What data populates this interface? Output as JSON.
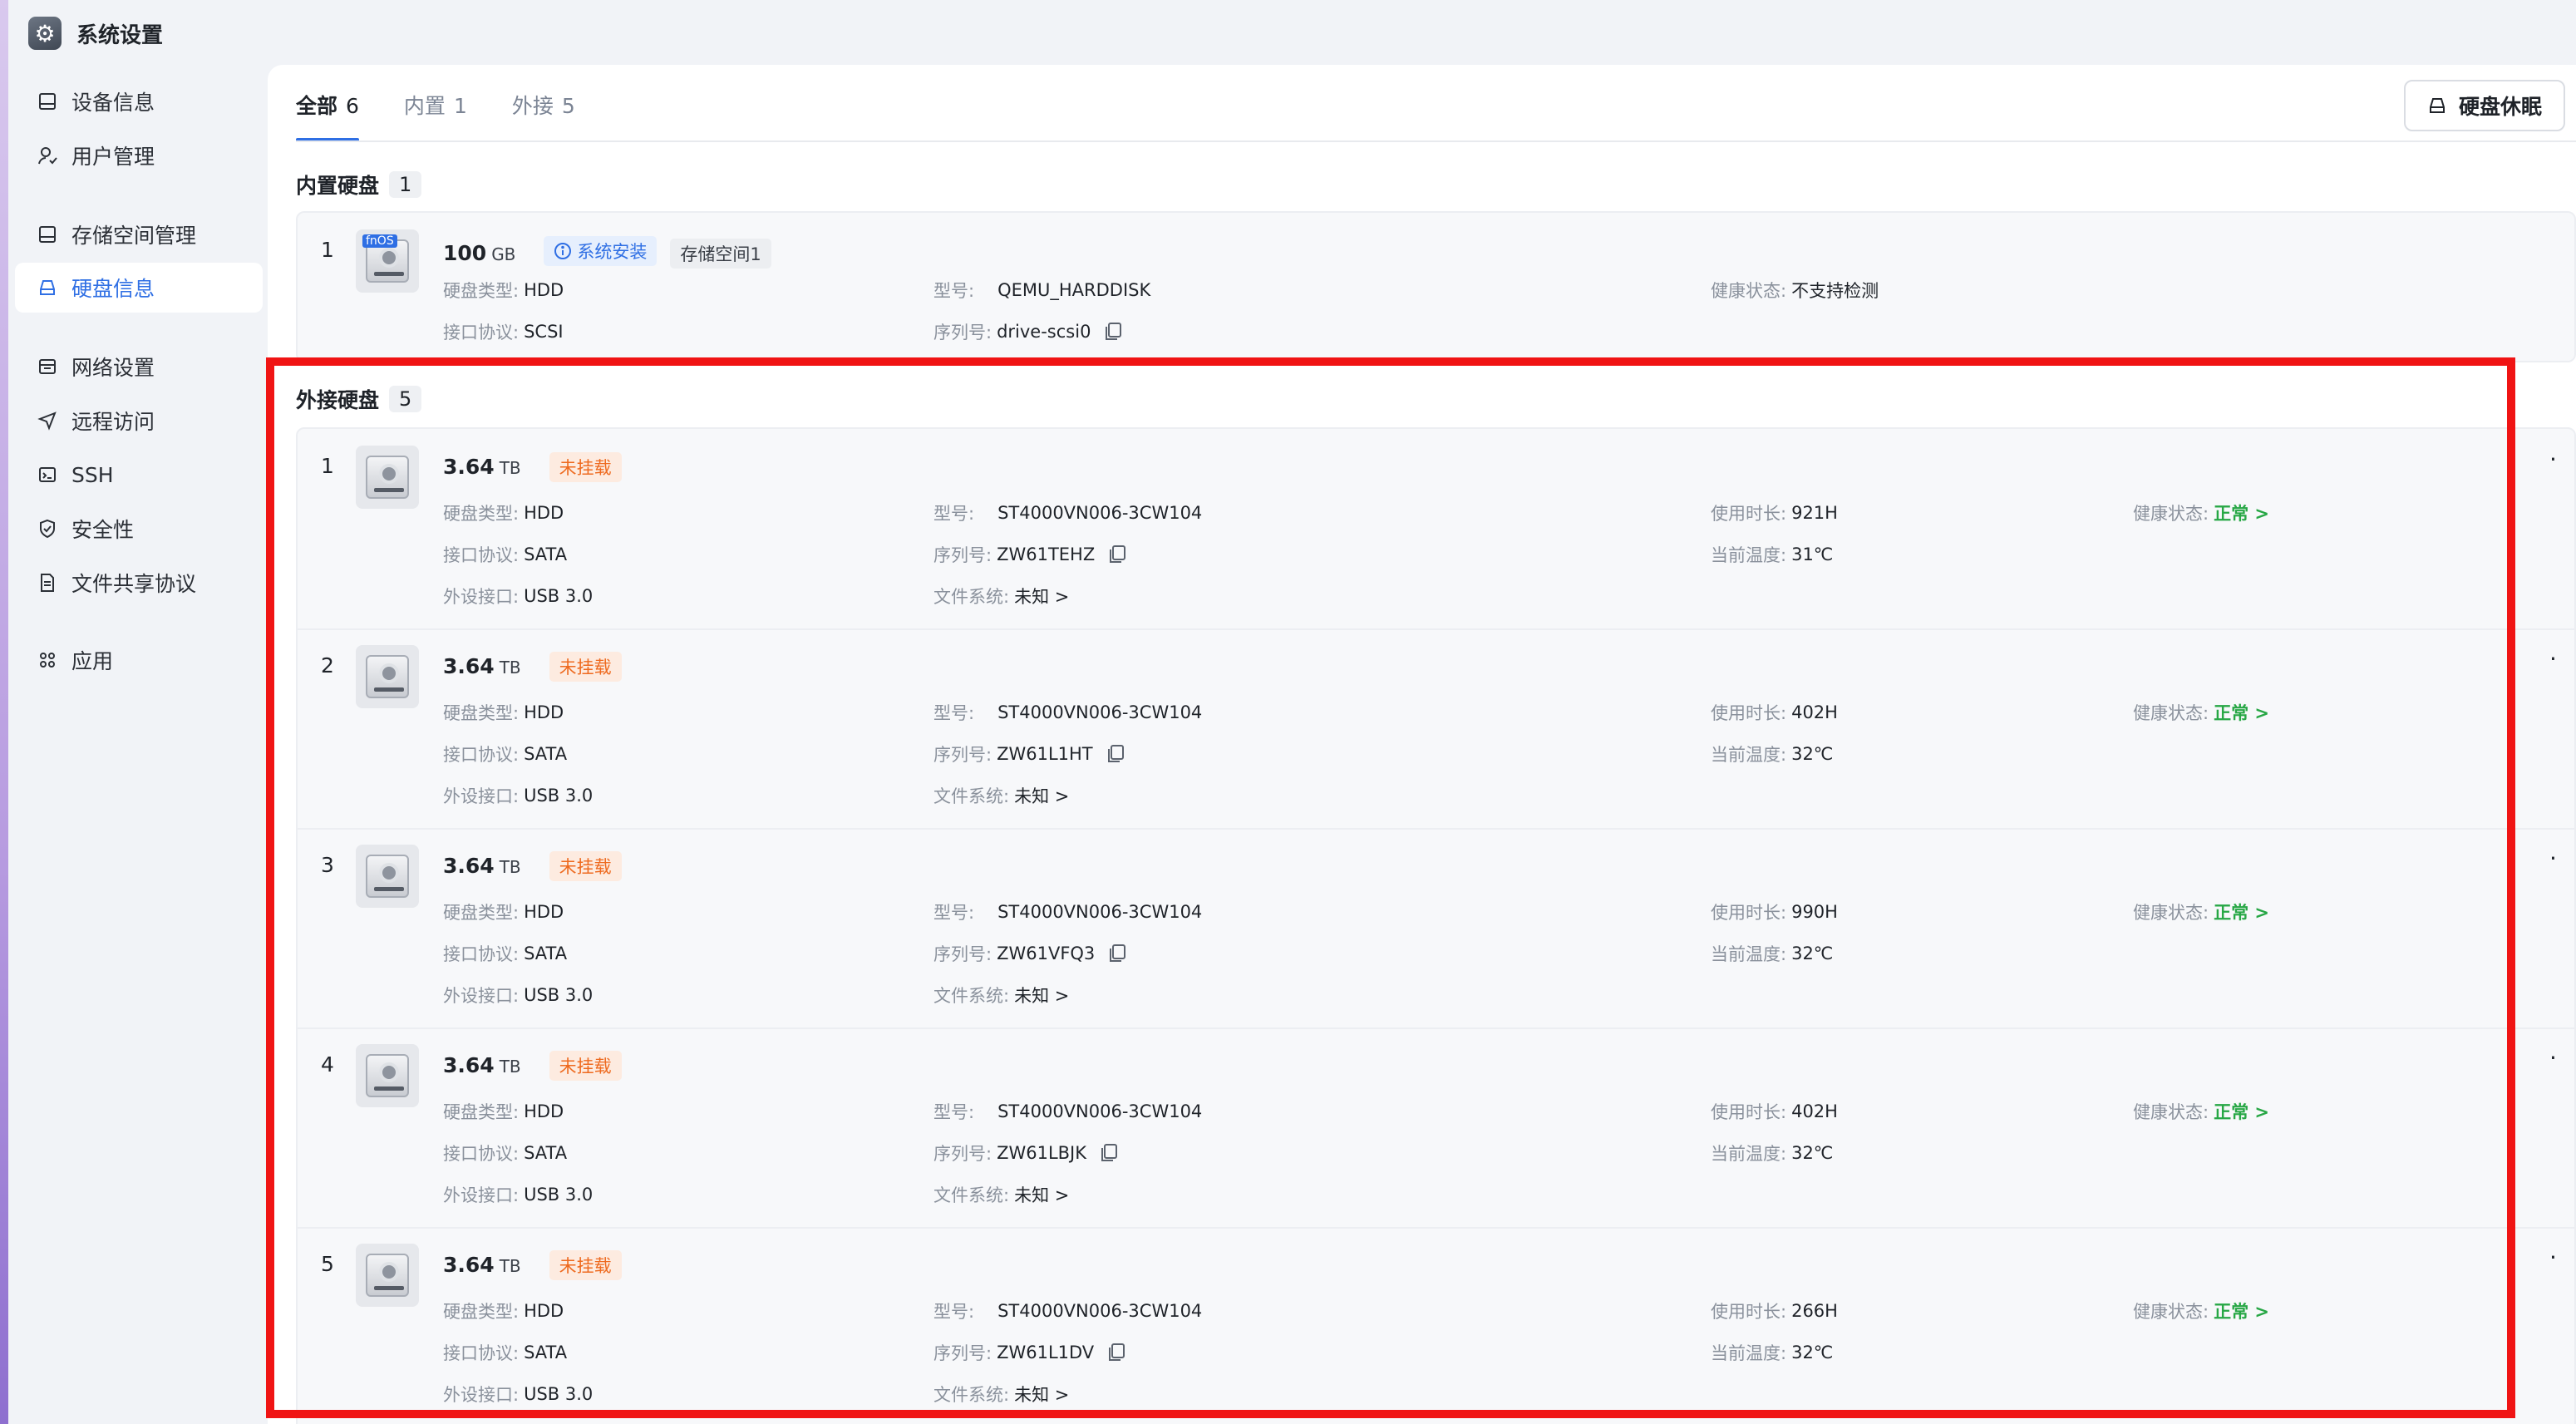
{
  "app": {
    "title": "系统设置",
    "icon": "gear-icon"
  },
  "sidebar": {
    "items": [
      {
        "label": "设备信息",
        "icon": "device-icon"
      },
      {
        "label": "用户管理",
        "icon": "user-icon"
      },
      {
        "label": "存储空间管理",
        "icon": "storage-icon"
      },
      {
        "label": "硬盘信息",
        "icon": "disk-icon",
        "active": true
      },
      {
        "label": "网络设置",
        "icon": "network-icon"
      },
      {
        "label": "远程访问",
        "icon": "send-icon"
      },
      {
        "label": "SSH",
        "icon": "terminal-icon"
      },
      {
        "label": "安全性",
        "icon": "shield-icon"
      },
      {
        "label": "文件共享协议",
        "icon": "file-icon"
      },
      {
        "label": "应用",
        "icon": "apps-icon"
      }
    ]
  },
  "tabs": [
    {
      "label": "全部",
      "count": "6",
      "active": true
    },
    {
      "label": "内置",
      "count": "1"
    },
    {
      "label": "外接",
      "count": "5"
    }
  ],
  "sleep_button": {
    "label": "硬盘休眠"
  },
  "internal": {
    "title": "内置硬盘",
    "count": "1",
    "disk": {
      "index": "1",
      "icon_tag": "fnOS",
      "capacity": "100",
      "unit": "GB",
      "badge_system": "系统安装",
      "badge_space": "存储空间1",
      "type_label": "硬盘类型:",
      "type": "HDD",
      "proto_label": "接口协议:",
      "proto": "SCSI",
      "model_label": "型号:",
      "model": "QEMU_HARDDISK",
      "serial_label": "序列号:",
      "serial": "drive-scsi0",
      "health_label": "健康状态:",
      "health": "不支持检测"
    }
  },
  "external": {
    "title": "外接硬盘",
    "count": "5",
    "labels": {
      "type": "硬盘类型:",
      "proto": "接口协议:",
      "port": "外设接口:",
      "model": "型号:",
      "serial": "序列号:",
      "fs": "文件系统:",
      "hours": "使用时长:",
      "temp": "当前温度:",
      "health": "健康状态:"
    },
    "disks": [
      {
        "index": "1",
        "capacity": "3.64",
        "unit": "TB",
        "status": "未挂载",
        "type": "HDD",
        "proto": "SATA",
        "port": "USB 3.0",
        "model": "ST4000VN006-3CW104",
        "serial": "ZW61TEHZ",
        "fs": "未知 >",
        "hours": "921H",
        "temp": "31℃",
        "health": "正常 >"
      },
      {
        "index": "2",
        "capacity": "3.64",
        "unit": "TB",
        "status": "未挂载",
        "type": "HDD",
        "proto": "SATA",
        "port": "USB 3.0",
        "model": "ST4000VN006-3CW104",
        "serial": "ZW61L1HT",
        "fs": "未知 >",
        "hours": "402H",
        "temp": "32℃",
        "health": "正常 >"
      },
      {
        "index": "3",
        "capacity": "3.64",
        "unit": "TB",
        "status": "未挂载",
        "type": "HDD",
        "proto": "SATA",
        "port": "USB 3.0",
        "model": "ST4000VN006-3CW104",
        "serial": "ZW61VFQ3",
        "fs": "未知 >",
        "hours": "990H",
        "temp": "32℃",
        "health": "正常 >"
      },
      {
        "index": "4",
        "capacity": "3.64",
        "unit": "TB",
        "status": "未挂载",
        "type": "HDD",
        "proto": "SATA",
        "port": "USB 3.0",
        "model": "ST4000VN006-3CW104",
        "serial": "ZW61LBJK",
        "fs": "未知 >",
        "hours": "402H",
        "temp": "32℃",
        "health": "正常 >"
      },
      {
        "index": "5",
        "capacity": "3.64",
        "unit": "TB",
        "status": "未挂载",
        "type": "HDD",
        "proto": "SATA",
        "port": "USB 3.0",
        "model": "ST4000VN006-3CW104",
        "serial": "ZW61L1DV",
        "fs": "未知 >",
        "hours": "266H",
        "temp": "32℃",
        "health": "正常 >"
      }
    ]
  },
  "colors": {
    "accent": "#2f6fe4",
    "warning": "#ee6a1f",
    "ok": "#27a745",
    "highlight": "#f01414"
  }
}
